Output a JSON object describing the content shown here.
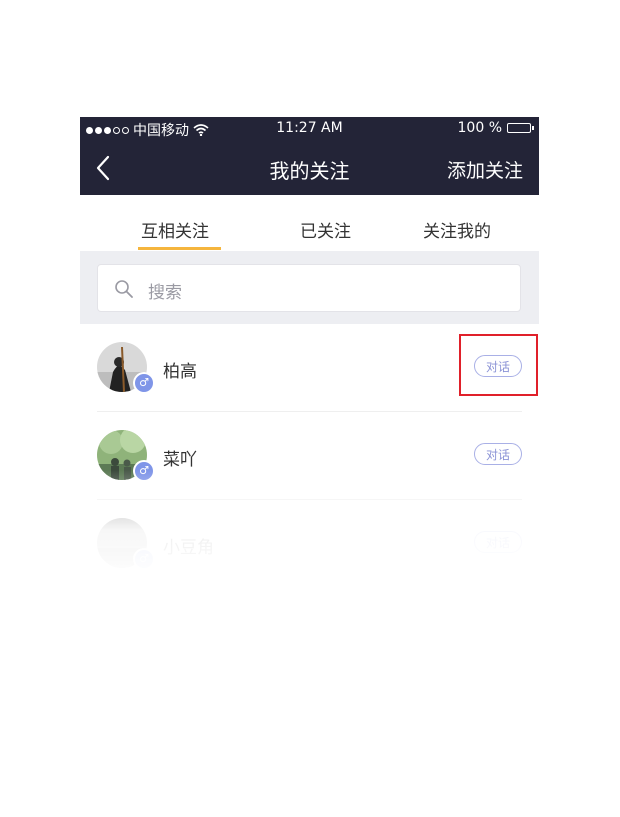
{
  "status_bar": {
    "carrier": "中国移动",
    "time": "11:27 AM",
    "battery": "100 %"
  },
  "nav": {
    "title": "我的关注",
    "action": "添加关注"
  },
  "tabs": [
    {
      "label": "互相关注",
      "active": true
    },
    {
      "label": "已关注",
      "active": false
    },
    {
      "label": "关注我的",
      "active": false
    }
  ],
  "search": {
    "placeholder": "搜索"
  },
  "list": [
    {
      "name": "柏高",
      "button": "对话"
    },
    {
      "name": "菜吖",
      "button": "对话"
    },
    {
      "name": "小豆角",
      "button": "对话"
    }
  ],
  "colors": {
    "header_bg": "#232437",
    "tab_indicator": "#f5b53d",
    "chat_button": "#8b93d6",
    "highlight": "#e0202a"
  }
}
